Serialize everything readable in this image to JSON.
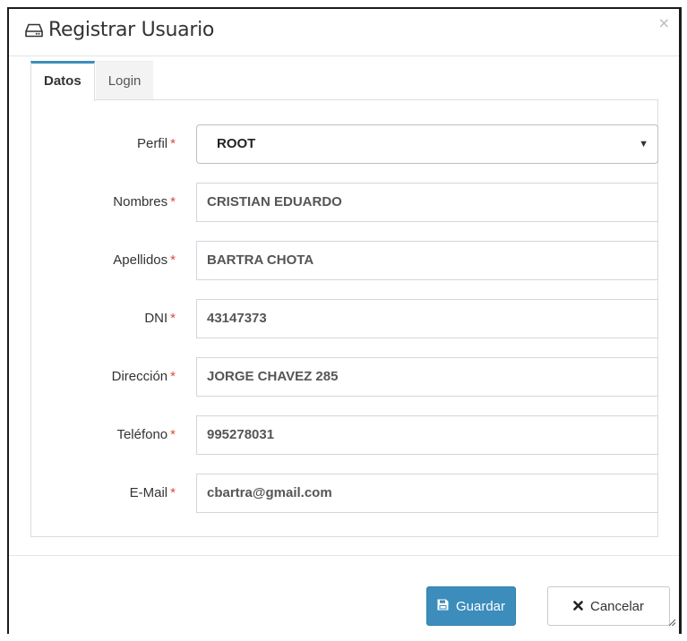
{
  "modal": {
    "title": "Registrar Usuario",
    "close_glyph": "×",
    "title_icon": "hdd-icon"
  },
  "tabs": [
    {
      "label": "Datos",
      "active": true
    },
    {
      "label": "Login",
      "active": false
    }
  ],
  "form": {
    "required_mark": "*",
    "fields": [
      {
        "label": "Perfil",
        "value": "ROOT",
        "type": "select"
      },
      {
        "label": "Nombres",
        "value": "CRISTIAN EDUARDO",
        "type": "text"
      },
      {
        "label": "Apellidos",
        "value": "BARTRA CHOTA",
        "type": "text"
      },
      {
        "label": "DNI",
        "value": "43147373",
        "type": "text"
      },
      {
        "label": "Dirección",
        "value": "JORGE CHAVEZ 285",
        "type": "text"
      },
      {
        "label": "Teléfono",
        "value": "995278031",
        "type": "text"
      },
      {
        "label": "E-Mail",
        "value": "cbartra@gmail.com",
        "type": "email"
      }
    ]
  },
  "footer": {
    "save_label": "Guardar",
    "cancel_label": "Cancelar"
  },
  "colors": {
    "primary": "#3c8dbc",
    "required": "#dd4b39",
    "tab_active_border": "#3c8dbc"
  }
}
